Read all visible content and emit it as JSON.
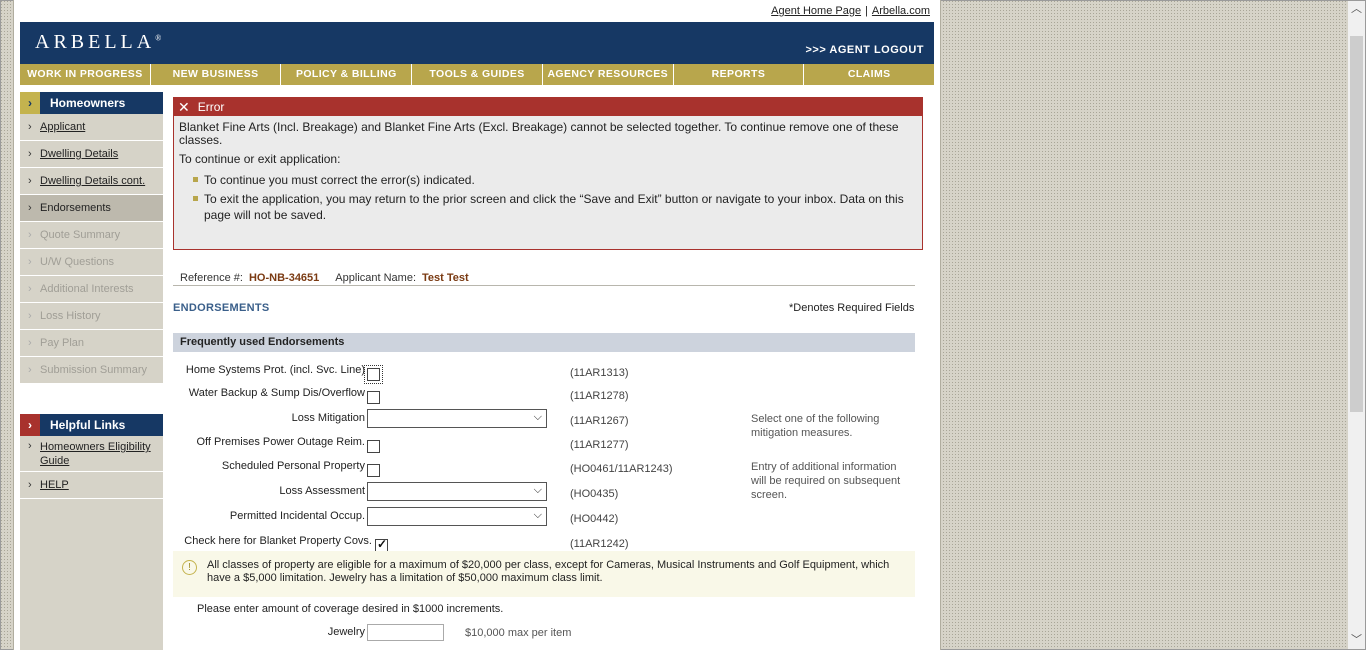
{
  "toplinks": {
    "agent_home": "Agent Home Page",
    "separator": "|",
    "arbella_com": "Arbella.com"
  },
  "header": {
    "logo": "ARBELLA",
    "logout": ">>> AGENT LOGOUT"
  },
  "nav": [
    "WORK IN PROGRESS",
    "NEW BUSINESS",
    "POLICY & BILLING",
    "TOOLS & GUIDES",
    "AGENCY RESOURCES",
    "REPORTS",
    "CLAIMS"
  ],
  "sidebar": {
    "heading": "Homeowners",
    "items": [
      {
        "label": "Applicant",
        "state": "link"
      },
      {
        "label": "Dwelling Details",
        "state": "link"
      },
      {
        "label": "Dwelling Details cont.",
        "state": "link"
      },
      {
        "label": "Endorsements",
        "state": "current"
      },
      {
        "label": "Quote Summary",
        "state": "disabled"
      },
      {
        "label": "U/W Questions",
        "state": "disabled"
      },
      {
        "label": "Additional Interests",
        "state": "disabled"
      },
      {
        "label": "Loss History",
        "state": "disabled"
      },
      {
        "label": "Pay Plan",
        "state": "disabled"
      },
      {
        "label": "Submission Summary",
        "state": "disabled"
      }
    ],
    "helpful_heading": "Helpful Links",
    "helpful_links": [
      "Homeowners Eligibility Guide",
      "HELP"
    ]
  },
  "error": {
    "title": "Error",
    "message": "Blanket Fine Arts (Incl. Breakage) and Blanket Fine Arts (Excl. Breakage) cannot be selected together. To continue remove one of these classes.",
    "prompt": "To continue or exit application:",
    "bullets": [
      "To continue you must correct the error(s) indicated.",
      "To exit the application, you may return to the prior screen and click the “Save and Exit” button or navigate to your inbox. Data on this page will not be saved."
    ]
  },
  "reference": {
    "ref_label": "Reference #:",
    "ref_value": "HO-NB-34651",
    "name_label": "Applicant Name:",
    "name_value": "Test Test"
  },
  "section_title": "ENDORSEMENTS",
  "required_note": "*Denotes Required Fields",
  "freq_heading": "Frequently used Endorsements",
  "endorsements": [
    {
      "label": "Home Systems Prot. (incl. Svc. Line)",
      "control": "checkbox",
      "checked": false,
      "code": "(11AR1313)"
    },
    {
      "label": "Water Backup & Sump Dis/Overflow",
      "control": "checkbox",
      "checked": false,
      "code": "(11AR1278)"
    },
    {
      "label": "Loss Mitigation",
      "control": "select",
      "value": "",
      "code": "(11AR1267)"
    },
    {
      "label": "Off Premises Power Outage Reim.",
      "control": "checkbox",
      "checked": false,
      "code": "(11AR1277)"
    },
    {
      "label": "Scheduled Personal Property",
      "control": "checkbox",
      "checked": false,
      "code": "(HO0461/11AR1243)"
    },
    {
      "label": "Loss Assessment",
      "control": "select",
      "value": "",
      "code": "(HO0435)"
    },
    {
      "label": "Permitted Incidental Occup.",
      "control": "select",
      "value": "",
      "code": "(HO0442)"
    },
    {
      "label": "Check here for Blanket Property Covs.",
      "control": "checkbox",
      "checked": true,
      "code": "(11AR1242)"
    }
  ],
  "notes": {
    "mitigation": "Select one of the following mitigation measures.",
    "scheduled": "Entry of additional information will be required on subsequent screen."
  },
  "info": "All classes of property are eligible for a maximum of $20,000 per class, except for Cameras, Musical Instruments and Golf Equipment, which have a $5,000 limitation. Jewelry has a limitation of $50,000 maximum class limit.",
  "coverage_prompt": "Please enter amount of coverage desired in $1000 increments.",
  "jewelry": {
    "label": "Jewelry",
    "value": "",
    "max_note": "$10,000 max per item"
  }
}
